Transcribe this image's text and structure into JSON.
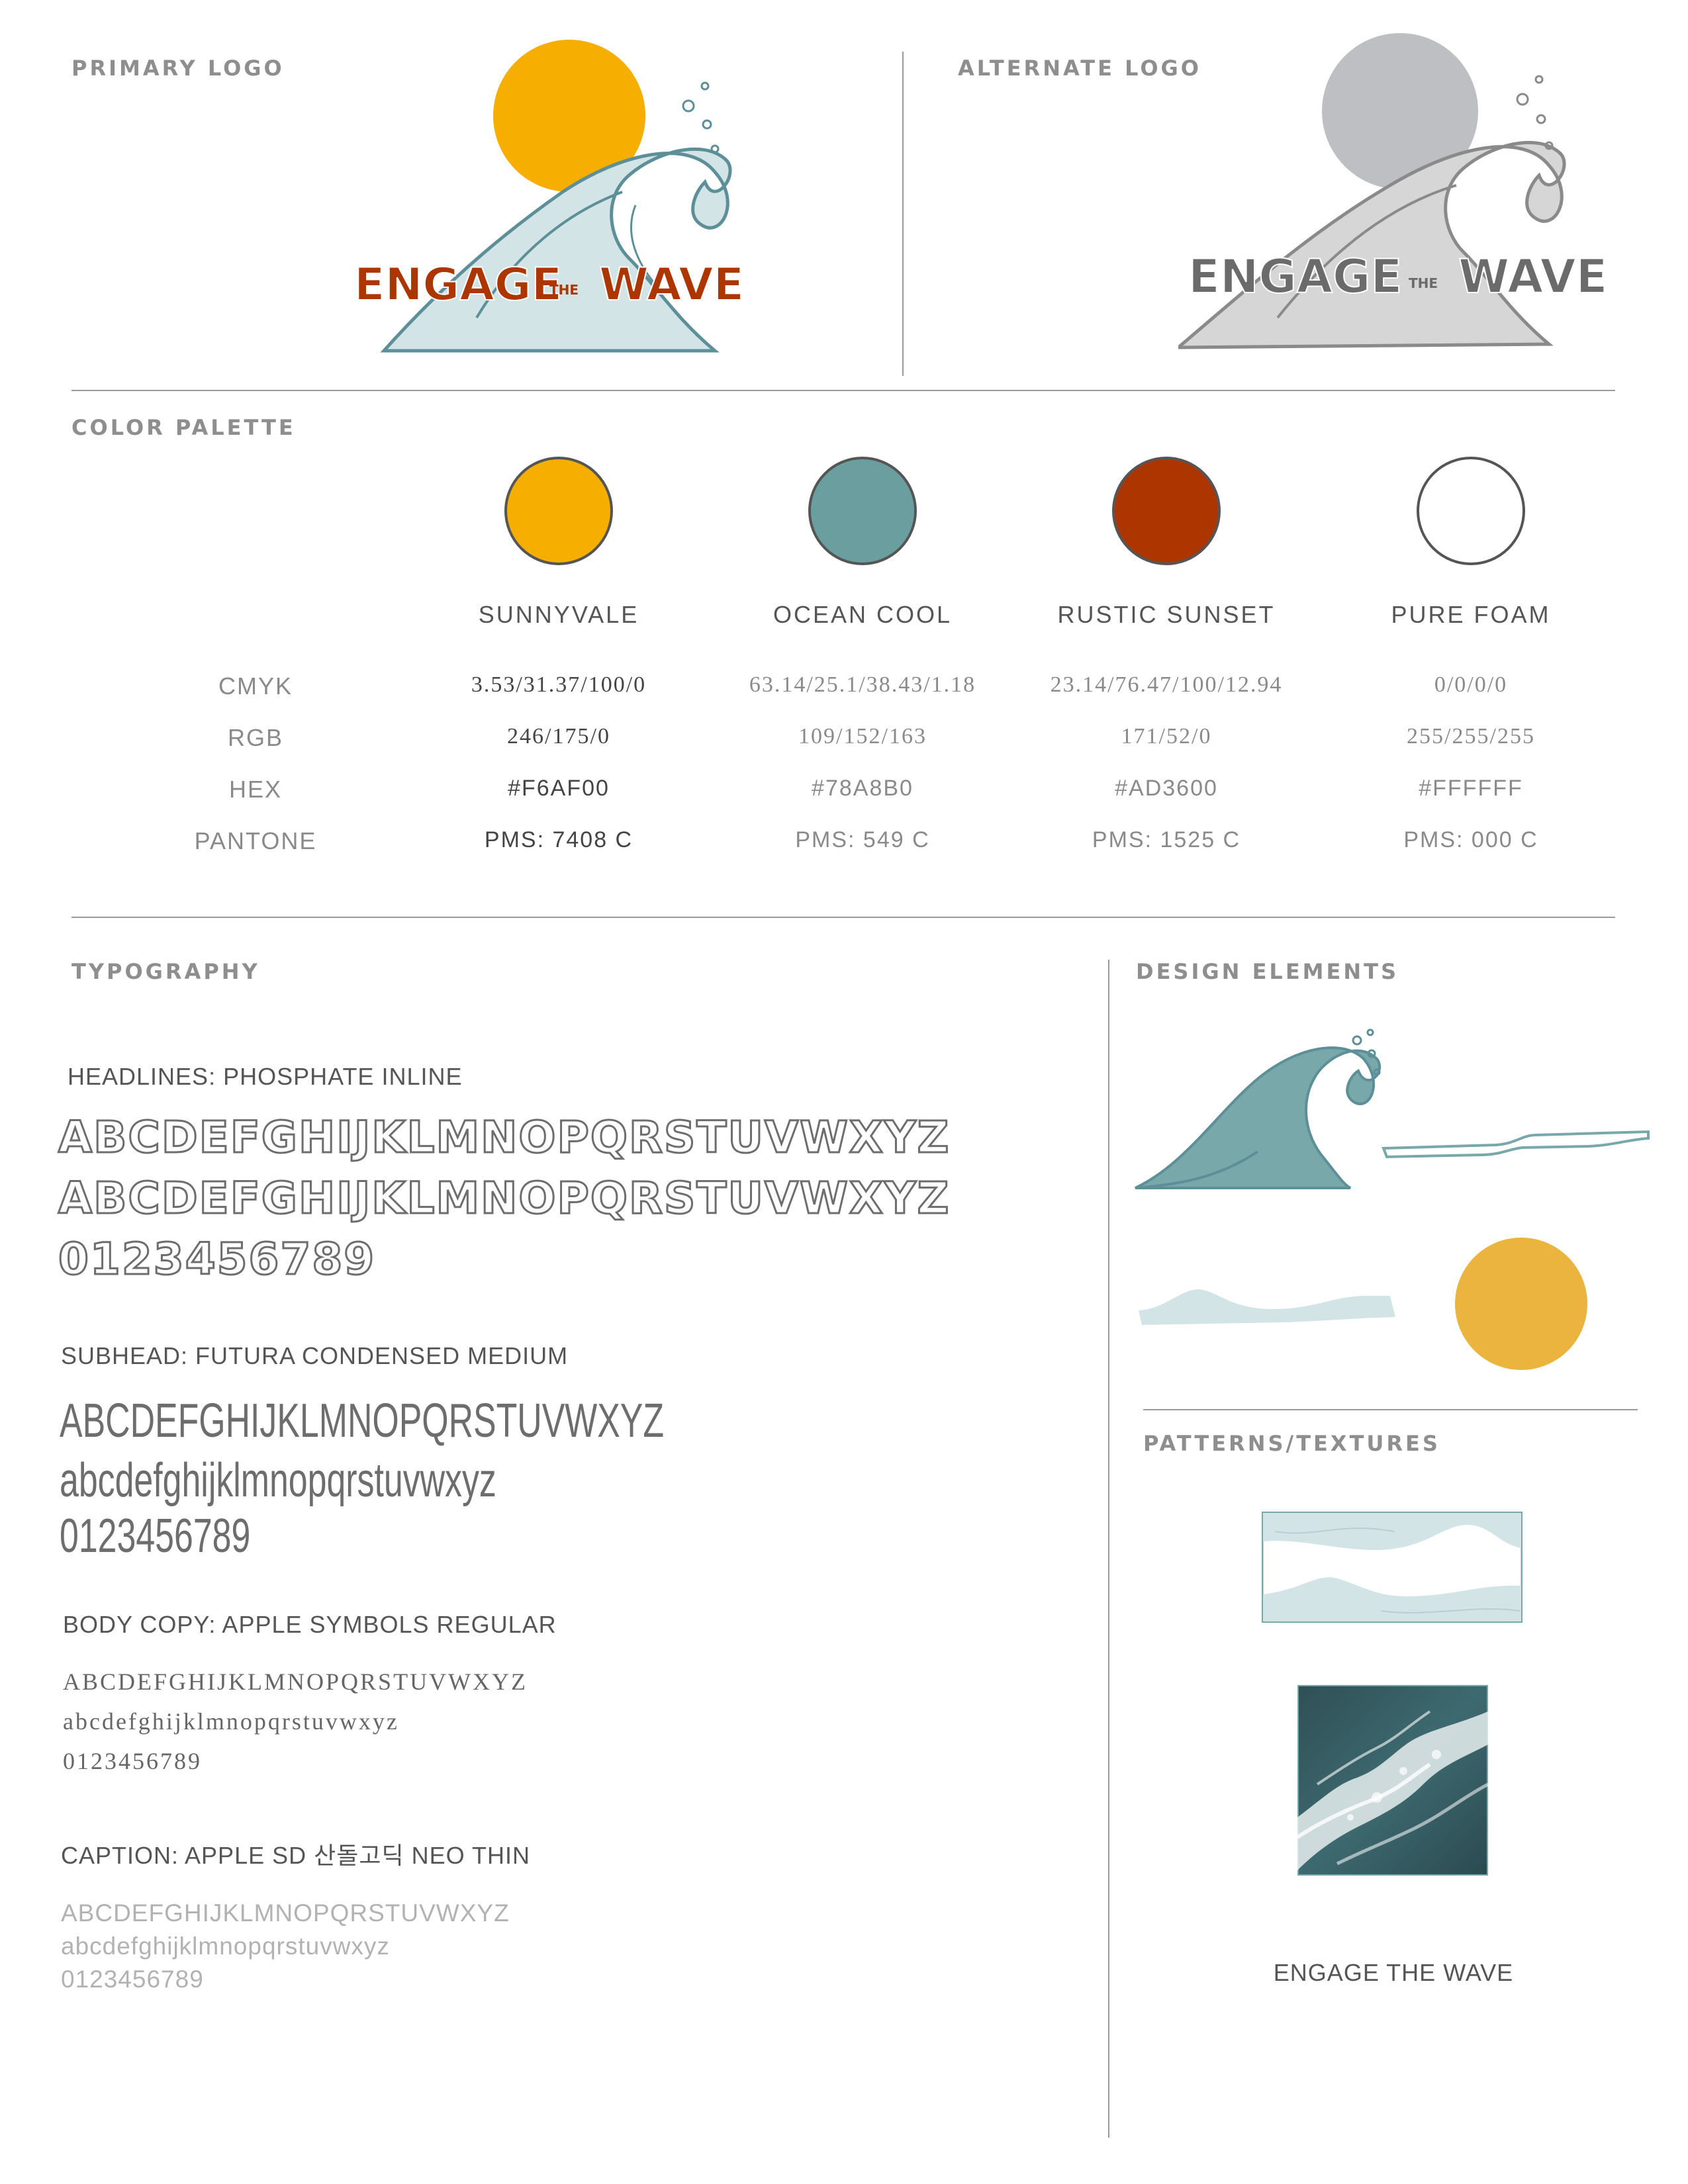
{
  "sections": {
    "primary_logo": "PRIMARY LOGO",
    "alternate_logo": "ALTERNATE LOGO",
    "color_palette": "COLOR PALETTE",
    "typography": "TYPOGRAPHY",
    "design_elements": "DESIGN ELEMENTS",
    "patterns_textures": "PATTERNS/TEXTURES"
  },
  "logo": {
    "word1": "ENGAGE",
    "word2": "THE",
    "word3": "WAVE",
    "primary_text_color": "#AD3600",
    "primary_sun_color": "#F6AF00",
    "alternate_text_color": "#6b6b6b",
    "alternate_sun_color": "#bebfc2"
  },
  "palette": {
    "row_labels": [
      "CMYK",
      "RGB",
      "HEX",
      "PANTONE"
    ],
    "swatches": [
      {
        "name": "SUNNYVALE",
        "color": "#F6AF00",
        "cmyk": "3.53/31.37/100/0",
        "rgb": "246/175/0",
        "hex": "#F6AF00",
        "pantone": "PMS: 7408 C"
      },
      {
        "name": "OCEAN COOL",
        "color": "#6a9e9f",
        "cmyk": "63.14/25.1/38.43/1.18",
        "rgb": "109/152/163",
        "hex": "#78A8B0",
        "pantone": "PMS: 549 C"
      },
      {
        "name": "RUSTIC SUNSET",
        "color": "#AD3600",
        "cmyk": "23.14/76.47/100/12.94",
        "rgb": "171/52/0",
        "hex": "#AD3600",
        "pantone": "PMS: 1525 C"
      },
      {
        "name": "PURE FOAM",
        "color": "#FFFFFF",
        "cmyk": "0/0/0/0",
        "rgb": "255/255/255",
        "hex": "#FFFFFF",
        "pantone": "PMS: 000 C"
      }
    ]
  },
  "typography": {
    "headlines": {
      "title": "HEADLINES: PHOSPHATE INLINE",
      "upper": "ABCDEFGHIJKLMNOPQRSTUVWXYZ",
      "upper2": "ABCDEFGHIJKLMNOPQRSTUVWXYZ",
      "digits": "0123456789"
    },
    "subhead": {
      "title": "SUBHEAD: FUTURA CONDENSED MEDIUM",
      "upper": "ABCDEFGHIJKLMNOPQRSTUVWXYZ",
      "lower": "abcdefghijklmnopqrstuvwxyz",
      "digits": "0123456789"
    },
    "body": {
      "title": "BODY COPY: APPLE SYMBOLS REGULAR",
      "upper": "ABCDEFGHIJKLMNOPQRSTUVWXYZ",
      "lower": "abcdefghijklmnopqrstuvwxyz",
      "digits": "0123456789"
    },
    "caption": {
      "title": "CAPTION: APPLE SD 산돌고딕 NEO THIN",
      "upper": "ABCDEFGHIJKLMNOPQRSTUVWXYZ",
      "lower": "abcdefghijklmnopqrstuvwxyz",
      "digits": "0123456789"
    }
  },
  "patterns": {
    "caption": "ENGAGE THE WAVE"
  },
  "colors": {
    "wave_fill": "#d3e4e6",
    "wave_line": "#5d8f98",
    "wave_dark": "#78a8aa",
    "element_sun": "#ebb43f",
    "rule": "#9a9a9a"
  }
}
